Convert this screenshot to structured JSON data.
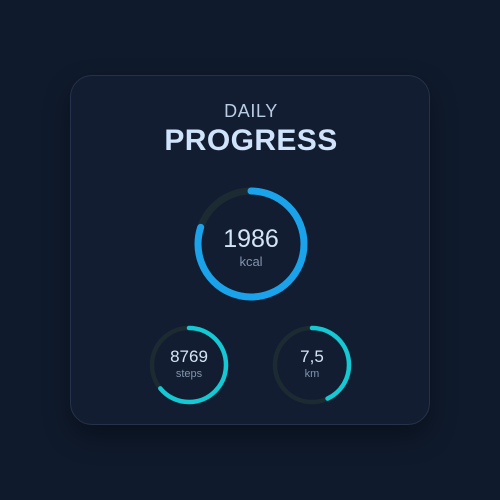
{
  "header": {
    "subtitle": "DAILY",
    "title": "PROGRESS"
  },
  "colors": {
    "background": "#0f1a2c",
    "card": "#131d31",
    "track": "#1c2a32",
    "calories_accent": "#1aa3ea",
    "activity_accent": "#14c9d3"
  },
  "metrics": {
    "calories": {
      "value": "1986",
      "unit": "kcal",
      "progress": 0.8
    },
    "steps": {
      "value": "8769",
      "unit": "steps",
      "progress": 0.64
    },
    "distance": {
      "value": "7,5",
      "unit": "km",
      "progress": 0.43
    }
  }
}
